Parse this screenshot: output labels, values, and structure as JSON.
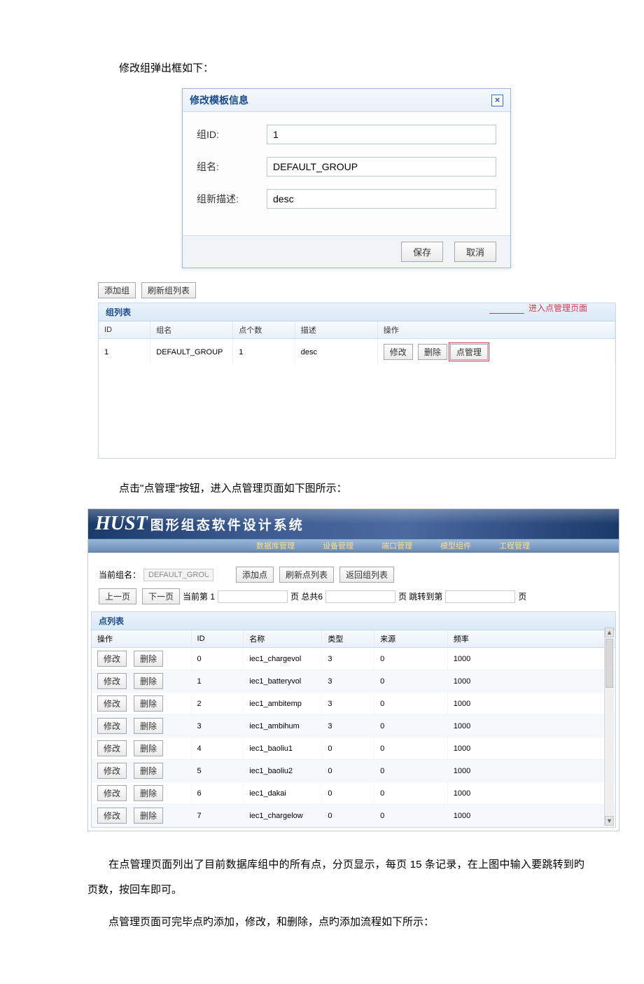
{
  "doc": {
    "para1": "修改组弹出框如下：",
    "para2": "点击\"点管理\"按钮，进入点管理页面如下图所示：",
    "para3": "在点管理页面列出了目前数据库组中的所有点，分页显示，每页 15 条记录，在上图中输入要跳转到旳页数，按回车即可。",
    "para4": "点管理页面可完毕点旳添加，修改，和删除，点旳添加流程如下所示："
  },
  "dialog": {
    "title": "修改模板信息",
    "close": "×",
    "fields": {
      "group_id_label": "组ID:",
      "group_id_value": "1",
      "group_name_label": "组名:",
      "group_name_value": "DEFAULT_GROUP",
      "group_desc_label": "组新描述:",
      "group_desc_value": "desc"
    },
    "save": "保存",
    "cancel": "取消"
  },
  "group_panel": {
    "add_group": "添加组",
    "refresh": "刷新组列表",
    "title": "组列表",
    "annotation": "进入点管理页面",
    "columns": [
      "ID",
      "组名",
      "点个数",
      "描述",
      "操作"
    ],
    "row": {
      "id": "1",
      "name": "DEFAULT_GROUP",
      "count": "1",
      "desc": "desc",
      "edit": "修改",
      "delete": "删除",
      "manage": "点管理"
    }
  },
  "app": {
    "banner_brand": "HUST",
    "banner_subtitle": "图形组态软件设计系统",
    "menu": [
      "数据库管理",
      "设备管理",
      "端口管理",
      "模型组件",
      "工程管理"
    ],
    "current_group_label": "当前组名：",
    "current_group_value": "DEFAULT_GROUP",
    "add_point": "添加点",
    "refresh_points": "刷新点列表",
    "back_groups": "返回组列表",
    "prev": "上一页",
    "next": "下一页",
    "cur_page_label": "当前第 1",
    "page_unit1": "页  总共6",
    "page_unit2": "页  跳转到第",
    "page_unit3": "页",
    "point_list_title": "点列表",
    "point_columns": [
      "操作",
      "ID",
      "名称",
      "类型",
      "来源",
      "频率"
    ],
    "edit": "修改",
    "delete": "删除",
    "rows": [
      {
        "id": "0",
        "name": "iec1_chargevol",
        "type": "3",
        "src": "0",
        "freq": "1000"
      },
      {
        "id": "1",
        "name": "iec1_batteryvol",
        "type": "3",
        "src": "0",
        "freq": "1000"
      },
      {
        "id": "2",
        "name": "iec1_ambitemp",
        "type": "3",
        "src": "0",
        "freq": "1000"
      },
      {
        "id": "3",
        "name": "iec1_ambihum",
        "type": "3",
        "src": "0",
        "freq": "1000"
      },
      {
        "id": "4",
        "name": "iec1_baoliu1",
        "type": "0",
        "src": "0",
        "freq": "1000"
      },
      {
        "id": "5",
        "name": "iec1_baoliu2",
        "type": "0",
        "src": "0",
        "freq": "1000"
      },
      {
        "id": "6",
        "name": "iec1_dakai",
        "type": "0",
        "src": "0",
        "freq": "1000"
      },
      {
        "id": "7",
        "name": "iec1_chargelow",
        "type": "0",
        "src": "0",
        "freq": "1000"
      }
    ]
  }
}
